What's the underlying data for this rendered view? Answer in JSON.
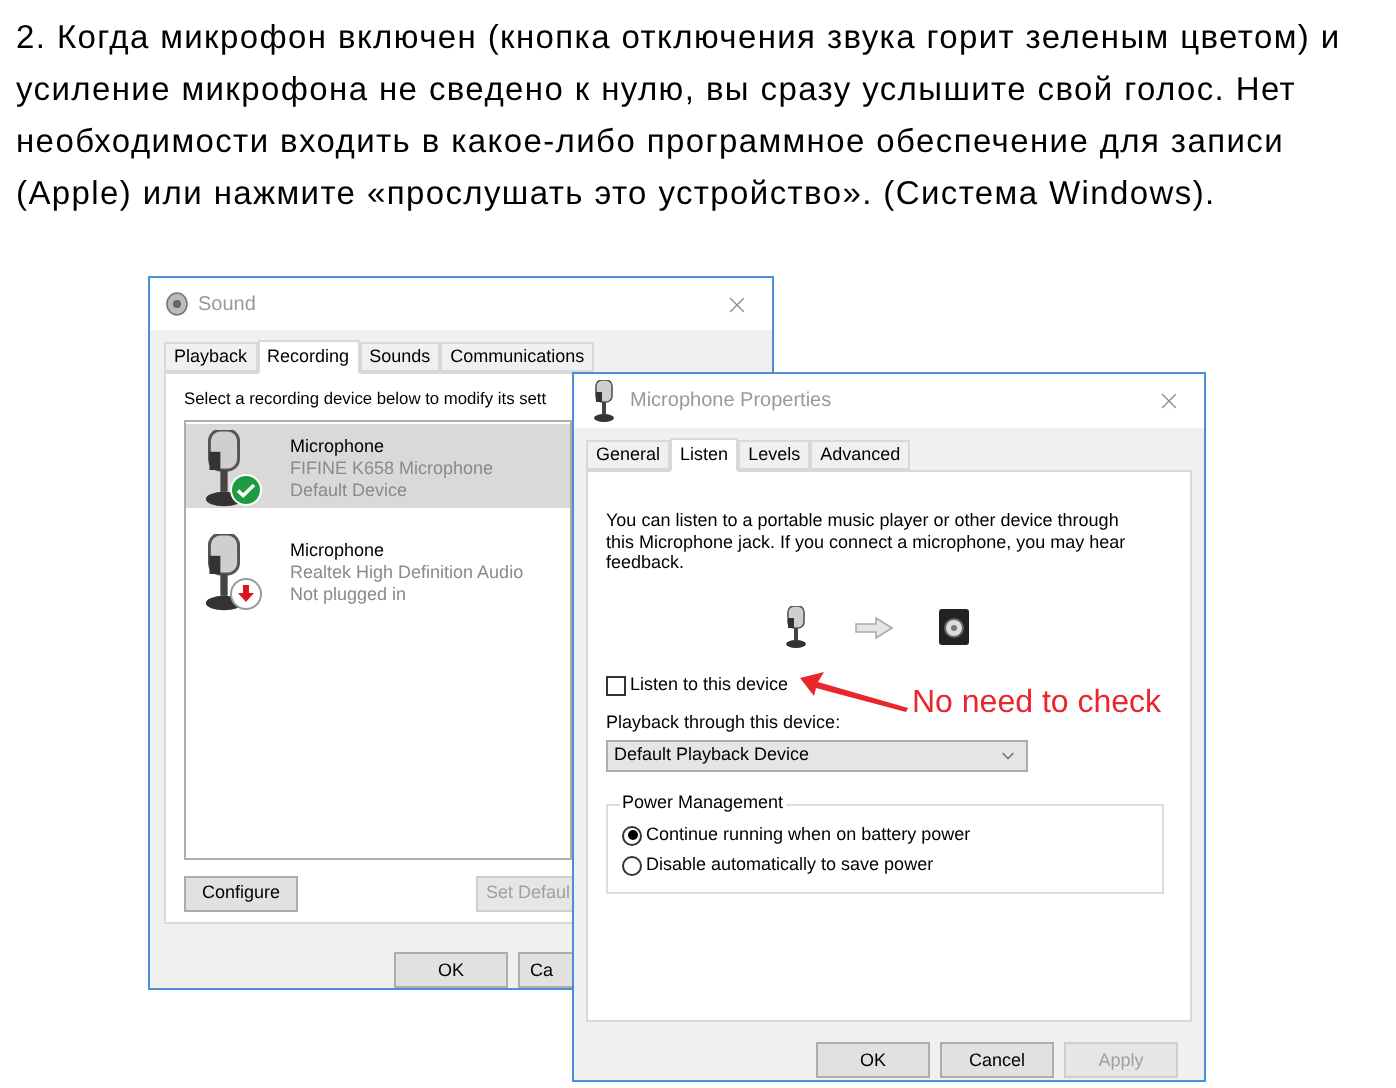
{
  "instruction": "2. Когда микрофон включен (кнопка отключения звука горит зеленым цветом) и усиление микрофона не сведено к нулю, вы сразу услышите свой голос. Нет необходимости входить в какое-либо программное обеспечение для записи (Apple) или нажмите «прослушать это устройство». (Система Windows).",
  "sound_window": {
    "title": "Sound",
    "tabs": [
      {
        "label": "Playback",
        "selected": false
      },
      {
        "label": "Recording",
        "selected": true
      },
      {
        "label": "Sounds",
        "selected": false
      },
      {
        "label": "Communications",
        "selected": false
      }
    ],
    "prompt": "Select a recording device below to modify its sett",
    "devices": [
      {
        "name": "Microphone",
        "detail": "FIFINE K658 Microphone",
        "status": "Default Device",
        "kind": "default",
        "selected": true
      },
      {
        "name": "Microphone",
        "detail": "Realtek High Definition Audio",
        "status": "Not plugged in",
        "kind": "unplugged",
        "selected": false
      }
    ],
    "configure_button": {
      "label": "Configure",
      "disabled": false
    },
    "set_default_button": {
      "label": "Set Defaul",
      "disabled": true
    },
    "buttons": [
      {
        "label": "OK",
        "disabled": false
      },
      {
        "label": "Ca",
        "disabled": false
      }
    ]
  },
  "properties_window": {
    "title": "Microphone Properties",
    "tabs": [
      {
        "label": "General",
        "selected": false
      },
      {
        "label": "Listen",
        "selected": true
      },
      {
        "label": "Levels",
        "selected": false
      },
      {
        "label": "Advanced",
        "selected": false
      }
    ],
    "description": "You can listen to a portable music player or other device through this Microphone jack.  If you connect a microphone, you may hear feedback.",
    "listen_checkbox": {
      "label": "Listen to this device",
      "checked": false
    },
    "playback_label": "Playback through this device:",
    "playback_device": "Default Playback Device",
    "power_management": {
      "title": "Power Management",
      "options": [
        {
          "label": "Continue running when on battery power",
          "selected": true
        },
        {
          "label": "Disable automatically to save power",
          "selected": false
        }
      ]
    },
    "buttons": [
      {
        "label": "OK",
        "disabled": false
      },
      {
        "label": "Cancel",
        "disabled": false
      },
      {
        "label": "Apply",
        "disabled": true
      }
    ]
  },
  "annotation": {
    "text": "No need to check"
  }
}
